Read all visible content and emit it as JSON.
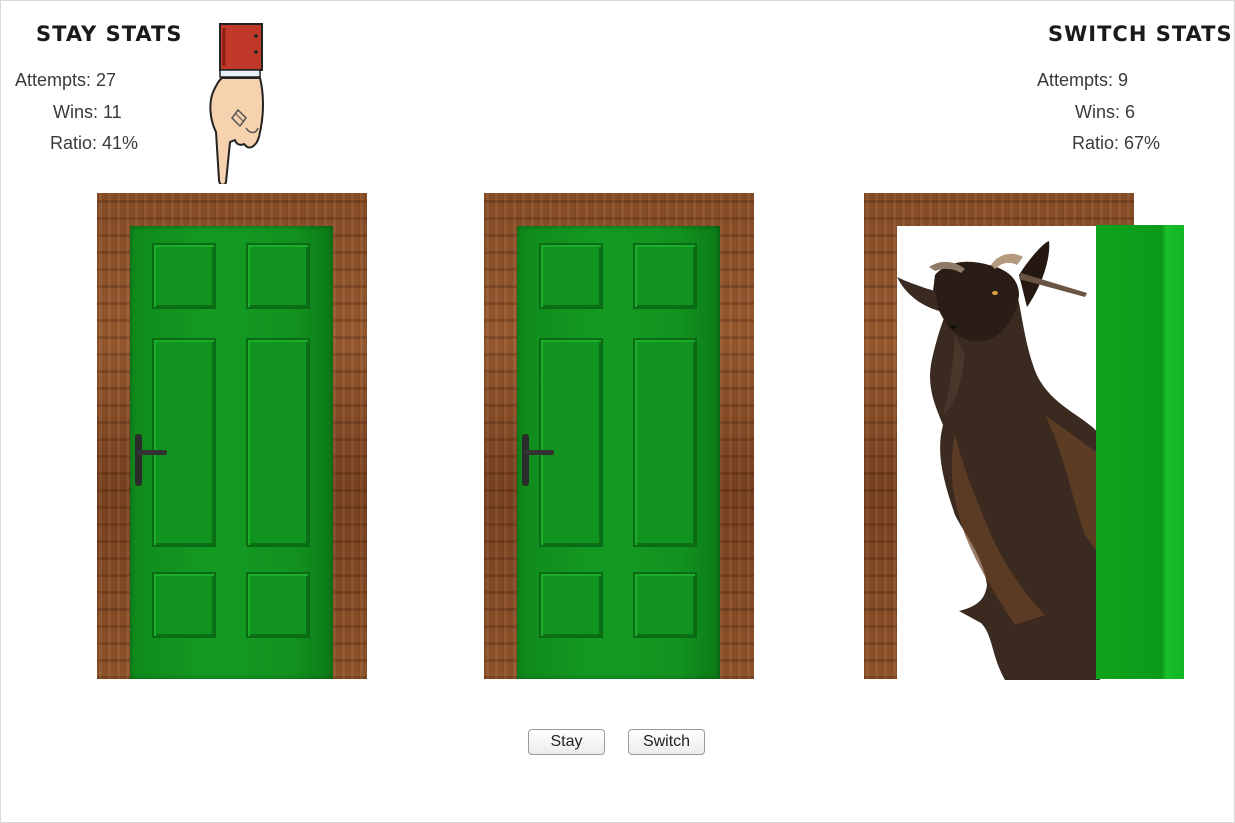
{
  "stay_stats": {
    "title": "Stay Stats",
    "attempts_label": "Attempts:",
    "attempts": "27",
    "wins_label": "Wins:",
    "wins": "11",
    "ratio_label": "Ratio:",
    "ratio": "41%"
  },
  "switch_stats": {
    "title": "Switch Stats",
    "attempts_label": "Attempts:",
    "attempts": "9",
    "wins_label": "Wins:",
    "wins": "6",
    "ratio_label": "Ratio:",
    "ratio": "67%"
  },
  "doors": [
    {
      "state": "closed",
      "selected": true
    },
    {
      "state": "closed",
      "selected": false
    },
    {
      "state": "open",
      "revealed": "goat"
    }
  ],
  "buttons": {
    "stay_label": "Stay",
    "switch_label": "Switch"
  },
  "colors": {
    "door_green": "#129320",
    "frame_wood": "#8a4f28",
    "cuff_red": "#c0392b"
  }
}
